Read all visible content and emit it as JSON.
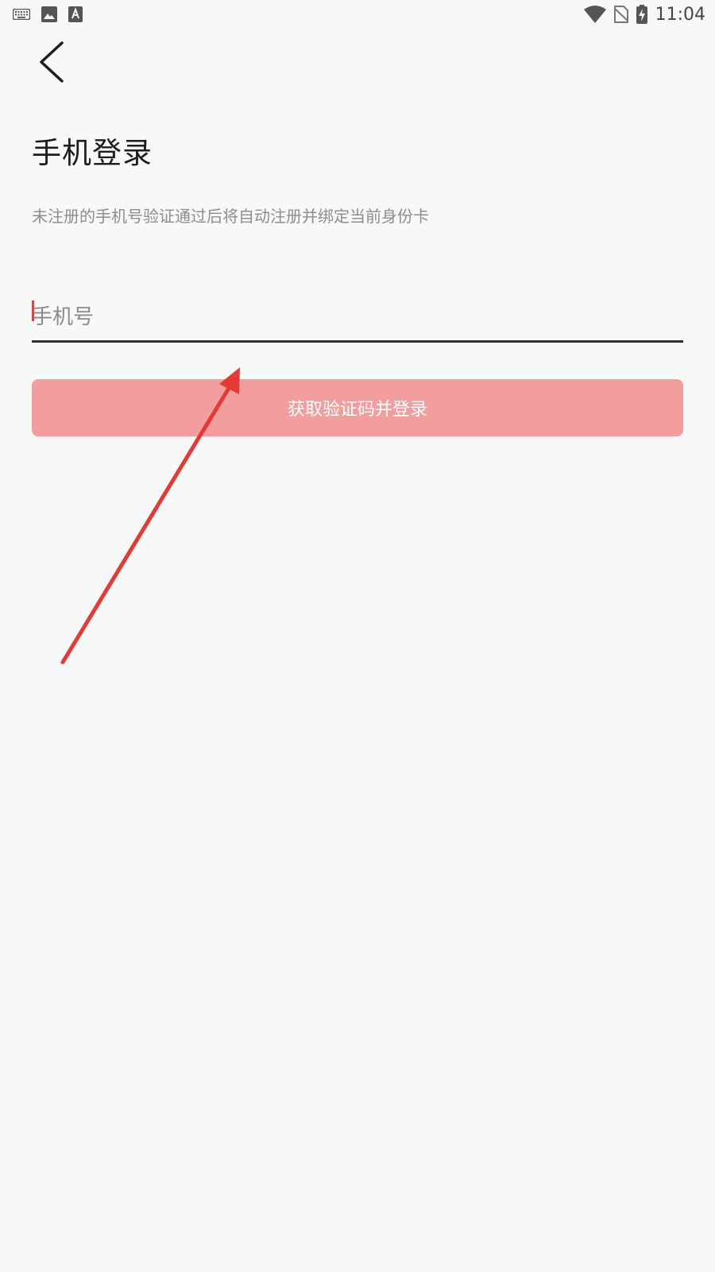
{
  "status_bar": {
    "time": "11:04",
    "left_icons": [
      "keyboard-icon",
      "image-icon",
      "text-icon"
    ],
    "right_icons": [
      "wifi-icon",
      "no-sim-icon",
      "battery-charging-icon"
    ]
  },
  "nav": {
    "back_icon": "chevron-left-icon"
  },
  "page": {
    "title": "手机登录",
    "subtitle": "未注册的手机号验证通过后将自动注册并绑定当前身份卡"
  },
  "form": {
    "phone_placeholder": "手机号",
    "phone_value": "",
    "submit_label": "获取验证码并登录"
  },
  "colors": {
    "background": "#f7f8f8",
    "button": "#f39e9e",
    "caret": "#e04040",
    "annotation_arrow": "#e53935"
  }
}
